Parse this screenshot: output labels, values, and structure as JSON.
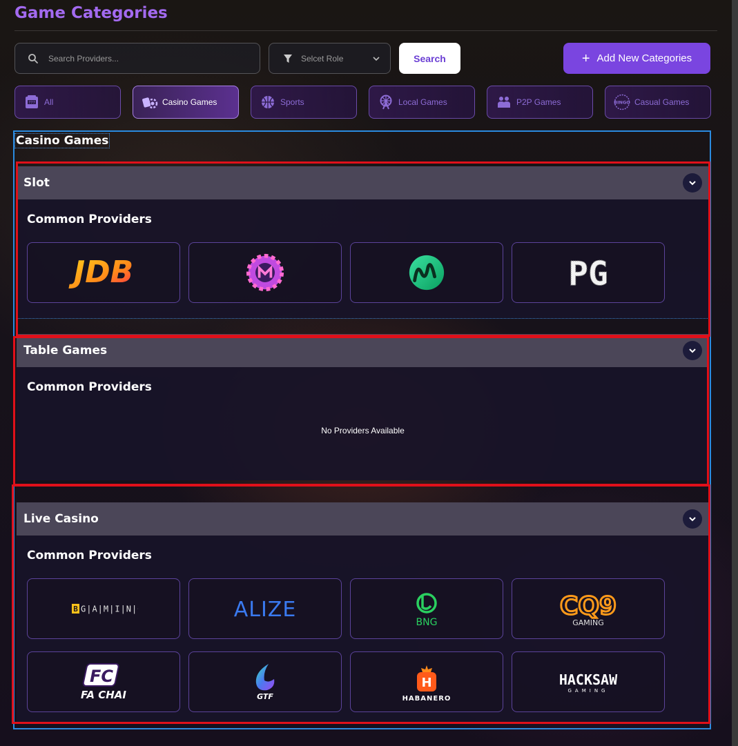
{
  "page": {
    "title": "Game Categories"
  },
  "toolbar": {
    "search_placeholder": "Search Providers...",
    "role_select_value": "Selcet Role",
    "search_label": "Search",
    "add_label": "Add New Categories"
  },
  "category_tabs": [
    {
      "label": "All",
      "icon": "slot-machine-icon",
      "active": false
    },
    {
      "label": "Casino Games",
      "icon": "casino-chips-icon",
      "active": true
    },
    {
      "label": "Sports",
      "icon": "basketball-icon",
      "active": false
    },
    {
      "label": "Local Games",
      "icon": "ferris-wheel-icon",
      "active": false
    },
    {
      "label": "P2P Games",
      "icon": "players-icon",
      "active": false
    },
    {
      "label": "Casual Games",
      "icon": "bingo-icon",
      "active": false
    }
  ],
  "panel": {
    "heading": "Casino Games"
  },
  "sections": [
    {
      "title": "Slot",
      "subtitle": "Common Providers",
      "providers": [
        "JDB",
        "",
        "",
        "PG"
      ]
    },
    {
      "title": "Table Games",
      "subtitle": "Common Providers",
      "empty_text": "No Providers Available"
    },
    {
      "title": "Live Casino",
      "subtitle": "Common Providers",
      "providers": [
        "BGAMING",
        "ALIZE",
        "BNG",
        "CQ9",
        "FA CHAI",
        "GTF",
        "HABANERO",
        "HACKSAW"
      ],
      "provider_sublabels": {
        "CQ9": "GAMING",
        "HACKSAW": "GAMING",
        "FC": "FC"
      }
    }
  ],
  "colors": {
    "title": "#a36af0",
    "accent": "#7a45e0",
    "panel_border": "#2a8be0",
    "highlight_border": "#e0101a",
    "section_header": "#4b4658"
  }
}
